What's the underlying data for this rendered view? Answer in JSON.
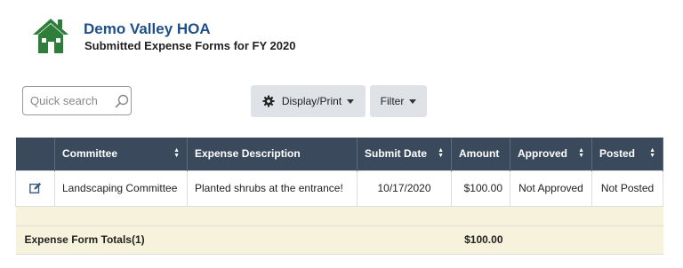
{
  "header": {
    "org_name": "Demo Valley HOA",
    "subtitle": "Submitted Expense Forms for FY 2020",
    "logo_icon": "house-icon",
    "logo_color": "#2e7d3a"
  },
  "toolbar": {
    "search_placeholder": "Quick search",
    "display_print_label": "Display/Print",
    "filter_label": "Filter"
  },
  "table": {
    "columns": [
      "Committee",
      "Expense Description",
      "Submit Date",
      "Amount",
      "Approved",
      "Posted"
    ],
    "rows": [
      {
        "committee": "Landscaping Committee",
        "description": "Planted shrubs at the entrance!",
        "submit_date": "10/17/2020",
        "amount": "$100.00",
        "approved": "Not Approved",
        "posted": "Not Posted"
      }
    ],
    "totals_label": "Expense Form Totals(1)",
    "totals_amount": "$100.00"
  },
  "colors": {
    "header_bg": "#3a4a5c",
    "totals_bg": "#f6f2dc",
    "title_color": "#1e4f8a",
    "edit_icon_color": "#3a5a80"
  }
}
